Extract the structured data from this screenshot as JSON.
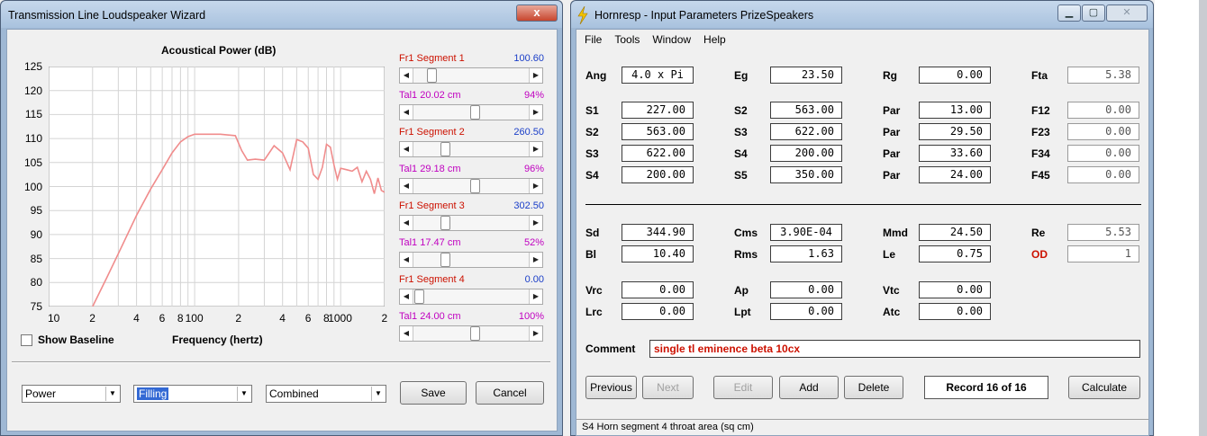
{
  "tl_window": {
    "title": "Transmission Line Loudspeaker Wizard",
    "close_label": "x",
    "show_baseline_label": "Show Baseline",
    "chart_data": {
      "type": "line",
      "title": "Acoustical Power (dB)",
      "xlabel": "Frequency (hertz)",
      "ylabel": "",
      "x_scale": "log",
      "xlim": [
        10,
        2000
      ],
      "ylim": [
        75,
        125
      ],
      "y_ticks": [
        "125",
        "120",
        "115",
        "110",
        "105",
        "100",
        "95",
        "90",
        "85",
        "80",
        "75"
      ],
      "x_ticks": [
        "10",
        "2",
        "4",
        "6",
        "8",
        "100",
        "2",
        "4",
        "6",
        "8",
        "1000",
        "2"
      ],
      "grid": true,
      "line_color": "#f08c8c",
      "series": [
        {
          "x": [
            20,
            25,
            30,
            40,
            50,
            60,
            70,
            80,
            90,
            100,
            120,
            150,
            190,
            210,
            230,
            260,
            300,
            350,
            400,
            450,
            500,
            550,
            600,
            650,
            700,
            750,
            800,
            850,
            900,
            950,
            1000,
            1100,
            1200,
            1300,
            1400,
            1500,
            1600,
            1700,
            1800,
            1900,
            2000
          ],
          "y": [
            75,
            81,
            86,
            94,
            99.5,
            103.5,
            107,
            109.3,
            110.4,
            110.9,
            110.9,
            110.9,
            110.6,
            107.5,
            105.5,
            105.7,
            105.5,
            108.5,
            107,
            103.5,
            109.8,
            109.3,
            108,
            102.5,
            101.5,
            104,
            108.8,
            108.2,
            104.5,
            101.5,
            103.8,
            103.5,
            103.2,
            104,
            101,
            103.2,
            101.5,
            98.5,
            101.8,
            99.2,
            98.8
          ]
        }
      ]
    },
    "segments": [
      {
        "label": "Fr1  Segment 1",
        "value": "100.60",
        "position": 0.12
      },
      {
        "label": "Tal1  20.02 cm",
        "value": "94%",
        "position": 0.52
      },
      {
        "label": "Fr1  Segment 2",
        "value": "260.50",
        "position": 0.24
      },
      {
        "label": "Tal1  29.18 cm",
        "value": "96%",
        "position": 0.52
      },
      {
        "label": "Fr1  Segment 3",
        "value": "302.50",
        "position": 0.24
      },
      {
        "label": "Tal1  17.47 cm",
        "value": "52%",
        "position": 0.24
      },
      {
        "label": "Fr1  Segment 4",
        "value": "0.00",
        "position": 0.0
      },
      {
        "label": "Tal1  24.00 cm",
        "value": "100%",
        "position": 0.52
      }
    ],
    "combo_power": "Power",
    "combo_filling": "Filling",
    "combo_combined": "Combined",
    "save_label": "Save",
    "cancel_label": "Cancel"
  },
  "hornresp": {
    "title": "Hornresp - Input Parameters   PrizeSpeakers",
    "menu": [
      "File",
      "Tools",
      "Window",
      "Help"
    ],
    "rows_top": [
      [
        {
          "l": "Ang",
          "v": "4.0 x Pi"
        },
        {
          "l": "Eg",
          "v": "23.50"
        },
        {
          "l": "Rg",
          "v": "0.00"
        },
        {
          "l": "Fta",
          "v": "5.38"
        }
      ],
      [
        {
          "l": "S1",
          "v": "227.00"
        },
        {
          "l": "S2",
          "v": "563.00"
        },
        {
          "l": "Par",
          "v": "13.00"
        },
        {
          "l": "F12",
          "v": "0.00"
        }
      ],
      [
        {
          "l": "S2",
          "v": "563.00"
        },
        {
          "l": "S3",
          "v": "622.00"
        },
        {
          "l": "Par",
          "v": "29.50"
        },
        {
          "l": "F23",
          "v": "0.00"
        }
      ],
      [
        {
          "l": "S3",
          "v": "622.00"
        },
        {
          "l": "S4",
          "v": "200.00"
        },
        {
          "l": "Par",
          "v": "33.60"
        },
        {
          "l": "F34",
          "v": "0.00"
        }
      ],
      [
        {
          "l": "S4",
          "v": "200.00"
        },
        {
          "l": "S5",
          "v": "350.00"
        },
        {
          "l": "Par",
          "v": "24.00"
        },
        {
          "l": "F45",
          "v": "0.00"
        }
      ]
    ],
    "rows_driver": [
      [
        {
          "l": "Sd",
          "v": "344.90"
        },
        {
          "l": "Cms",
          "v": "3.90E-04"
        },
        {
          "l": "Mmd",
          "v": "24.50"
        },
        {
          "l": "Re",
          "v": "5.53"
        }
      ],
      [
        {
          "l": "Bl",
          "v": "10.40"
        },
        {
          "l": "Rms",
          "v": "1.63"
        },
        {
          "l": "Le",
          "v": "0.75"
        },
        {
          "l": "OD",
          "v": "1"
        }
      ]
    ],
    "rows_chamber": [
      [
        {
          "l": "Vrc",
          "v": "0.00"
        },
        {
          "l": "Ap",
          "v": "0.00"
        },
        {
          "l": "Vtc",
          "v": "0.00"
        }
      ],
      [
        {
          "l": "Lrc",
          "v": "0.00"
        },
        {
          "l": "Lpt",
          "v": "0.00"
        },
        {
          "l": "Atc",
          "v": "0.00"
        }
      ]
    ],
    "comment_label": "Comment",
    "comment_value": "single tl eminence beta 10cx",
    "btn_previous": "Previous",
    "btn_next": "Next",
    "btn_edit": "Edit",
    "btn_add": "Add",
    "btn_delete": "Delete",
    "record": "Record 16 of 16",
    "btn_calculate": "Calculate",
    "status": "S4    Horn segment 4 throat area  (sq cm)",
    "od_color": "#cc1100"
  }
}
